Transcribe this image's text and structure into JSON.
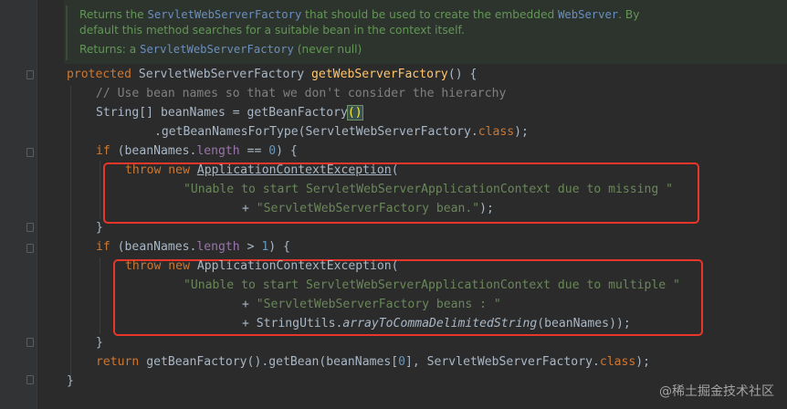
{
  "doc": {
    "line1_prefix": "Returns the ",
    "line1_code1": "ServletWebServerFactory",
    "line1_mid": " that should be used to create the embedded ",
    "line1_code2": "WebServer",
    "line1_suffix": ". By",
    "line2": "default this method searches for a suitable bean in the context itself.",
    "returns_label": "Returns:",
    "returns_a": "a",
    "returns_code": "ServletWebServerFactory",
    "returns_suffix": "(never null)"
  },
  "code": {
    "l1": {
      "kw": "protected",
      "type": " ServletWebServerFactory ",
      "fn": "getWebServerFactory",
      "rest": "() {"
    },
    "l2": {
      "comment": "// Use bean names so that we don't consider the hierarchy"
    },
    "l3": {
      "a": "String[] beanNames = getBeanFactory",
      "paren": "()",
      "b": ""
    },
    "l4": {
      "a": ".getBeanNamesForType(ServletWebServerFactory.",
      "kw": "class",
      "b": ");"
    },
    "l5": {
      "kw": "if",
      "a": " (beanNames.",
      "fld": "length",
      "b": " == ",
      "num": "0",
      "c": ") {"
    },
    "l6": {
      "kw": "throw new",
      "sp": " ",
      "link": "ApplicationContextException",
      "rest": "("
    },
    "l7": {
      "str": "\"Unable to start ServletWebServerApplicationContext due to missing \""
    },
    "l8": {
      "plus": "+ ",
      "str": "\"ServletWebServerFactory bean.\"",
      "rest": ");"
    },
    "l9": {
      "text": "}"
    },
    "l10": {
      "kw": "if",
      "a": " (beanNames.",
      "fld": "length",
      "b": " > ",
      "num": "1",
      "c": ") {"
    },
    "l11": {
      "kw": "throw new",
      "rest": " ApplicationContextException("
    },
    "l12": {
      "str": "\"Unable to start ServletWebServerApplicationContext due to multiple \""
    },
    "l13": {
      "plus": "+ ",
      "str": "\"ServletWebServerFactory beans : \""
    },
    "l14": {
      "plus": "+ StringUtils.",
      "it": "arrayToCommaDelimitedString",
      "rest": "(beanNames));"
    },
    "l15": {
      "text": "}"
    },
    "l16": {
      "kw": "return",
      "a": " getBeanFactory().getBean(beanNames[",
      "num": "0",
      "b": "], ServletWebServerFactory.",
      "kw2": "class",
      "c": ");"
    },
    "l17": {
      "text": "}"
    }
  },
  "watermark": "@稀土掘金技术社区",
  "colors": {
    "background": "#2b2b2b",
    "keyword": "#cc7832",
    "method": "#ffc66d",
    "string": "#6a8759",
    "number": "#6897bb",
    "comment": "#808080",
    "doc_text": "#629755",
    "highlight_box": "#e8362a"
  }
}
